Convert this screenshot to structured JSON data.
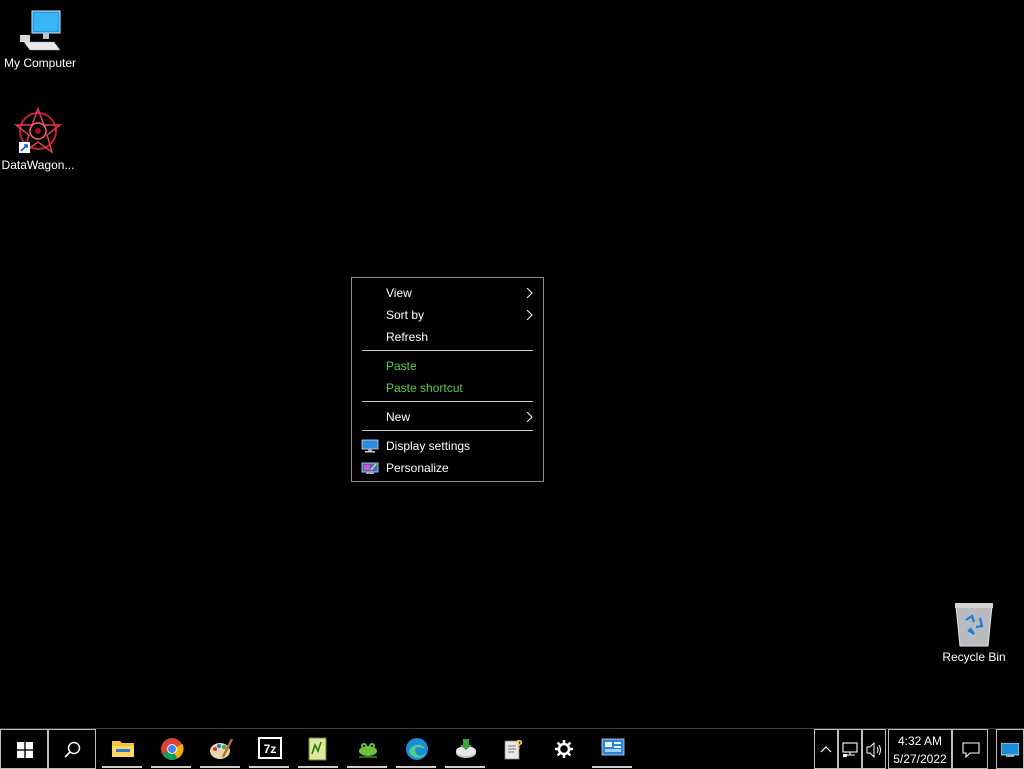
{
  "desktop": {
    "icons": [
      {
        "label": "My Computer",
        "icon": "computer-icon"
      },
      {
        "label": "DataWagon...",
        "icon": "datawagon-icon"
      },
      {
        "label": "Recycle Bin",
        "icon": "recycle-bin-icon"
      }
    ]
  },
  "context_menu": {
    "items": [
      {
        "label": "View",
        "has_submenu": true,
        "enabled": true
      },
      {
        "label": "Sort by",
        "has_submenu": true,
        "enabled": true
      },
      {
        "label": "Refresh",
        "has_submenu": false,
        "enabled": true
      },
      {
        "label": "Paste",
        "has_submenu": false,
        "enabled": false
      },
      {
        "label": "Paste shortcut",
        "has_submenu": false,
        "enabled": false
      },
      {
        "label": "New",
        "has_submenu": true,
        "enabled": true
      },
      {
        "label": "Display settings",
        "icon": "display-settings-icon",
        "enabled": true
      },
      {
        "label": "Personalize",
        "icon": "personalize-icon",
        "enabled": true
      }
    ],
    "disabled_color": "#5fc84a",
    "border_color": "#8a8a8a"
  },
  "taskbar": {
    "start_icon": "windows-logo-icon",
    "search_icon": "search-icon",
    "apps": [
      {
        "icon": "file-explorer-icon"
      },
      {
        "icon": "chrome-icon"
      },
      {
        "icon": "paint-icon"
      },
      {
        "icon": "7zip-icon"
      },
      {
        "icon": "notepad-plus-icon"
      },
      {
        "icon": "frog-tool-icon"
      },
      {
        "icon": "edge-icon"
      },
      {
        "icon": "disk-tool-icon"
      },
      {
        "icon": "help-doc-icon"
      },
      {
        "icon": "settings-gear-icon"
      },
      {
        "icon": "control-panel-icon"
      }
    ],
    "tray": {
      "chevron_icon": "chevron-up-icon",
      "network_icon": "network-icon",
      "volume_icon": "volume-icon",
      "time": "4:32 AM",
      "date": "5/27/2022",
      "notification_icon": "action-center-icon",
      "show_desktop_icon": "show-desktop-icon"
    }
  }
}
